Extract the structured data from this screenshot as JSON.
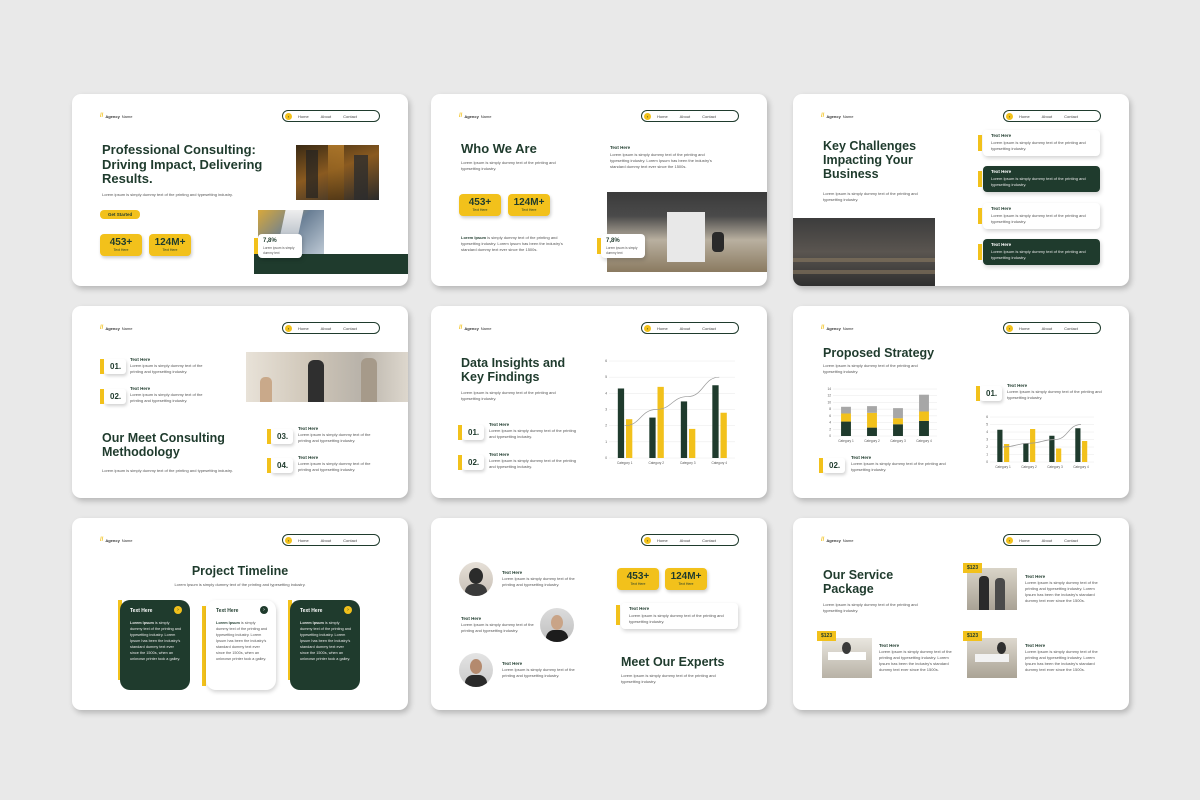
{
  "brand": {
    "name": "Agency",
    "name2": "Name"
  },
  "nav": {
    "home": "Home",
    "about": "About",
    "contact": "Contact"
  },
  "colors": {
    "yellow": "#f2c11b",
    "green": "#1f3b2d"
  },
  "lorem_short": "Lorem Ipsum is simply dummy text of the printing and typesetting industry.",
  "text_here": "Text Here",
  "s1": {
    "title": "Professional Consulting: Driving Impact, Delivering Results.",
    "sub": "Lorem ipsum is simply dummy text of the printing and typesetting industry.",
    "button": "Get Started",
    "stat1": "453+",
    "stat2": "124M+",
    "stat_cap": "Text Here",
    "mini_val": "7,8%",
    "mini_text": "Lorem ipsum is simply dummy text"
  },
  "s2": {
    "title": "Who We Are",
    "sub": "Lorem Ipsum is simply dummy text of the printing and typesetting industry.",
    "label": "Text Here",
    "right_text": "Lorem Ipsum is simply dummy text of the printing and typesetting industry. Lorem Ipsum has been the industry's standard dummy text ever since the 1500s.",
    "stat1": "453+",
    "stat2": "124M+",
    "stat_cap": "Text Here",
    "bottom_bold": "Lorem Ipsum",
    "bottom_text": "is simply dummy text of the printing and typesetting industry. Lorem Ipsum has been the industry's standard dummy text ever since the 1500s.",
    "mini_val": "7,8%",
    "mini_text": "Lorem ipsum is simply dummy text"
  },
  "s3": {
    "title": "Key Challenges Impacting Your Business",
    "sub": "Lorem Ipsum is simply dummy text of the printing and typesetting industry.",
    "items": [
      {
        "label": "Text Here",
        "text": "Lorem Ipsum is simply dummy text of the printing and typesetting industry."
      },
      {
        "label": "Text Here",
        "text": "Lorem Ipsum is simply dummy text of the printing and typesetting industry."
      },
      {
        "label": "Text Here",
        "text": "Lorem Ipsum is simply dummy text of the printing and typesetting industry."
      },
      {
        "label": "Text Here",
        "text": "Lorem Ipsum is simply dummy text of the printing and typesetting industry."
      }
    ]
  },
  "s4": {
    "title": "Our Meet Consulting Methodology",
    "sub": "Lorem ipsum is simply dummy text of the printing and typesetting industry.",
    "steps": [
      {
        "num": "01.",
        "label": "Text Here",
        "text": "Lorem ipsum is simply dummy text of the printing and typesetting industry."
      },
      {
        "num": "02.",
        "label": "Text Here",
        "text": "Lorem ipsum is simply dummy text of the printing and typesetting industry."
      },
      {
        "num": "03.",
        "label": "Text Here",
        "text": "Lorem ipsum is simply dummy text of the printing and typesetting industry."
      },
      {
        "num": "04.",
        "label": "Text Here",
        "text": "Lorem ipsum is simply dummy text of the printing and typesetting industry."
      }
    ]
  },
  "s5": {
    "title": "Data Insights and Key Findings",
    "sub": "Lorem Ipsum is simply dummy text of the printing and typesetting industry.",
    "steps": [
      {
        "num": "01.",
        "label": "Text Here",
        "text": "Lorem Ipsum is simply dummy text of the printing and typesetting industry."
      },
      {
        "num": "02.",
        "label": "Text Here",
        "text": "Lorem Ipsum is simply dummy text of the printing and typesetting industry."
      }
    ]
  },
  "s6": {
    "title": "Proposed Strategy",
    "sub": "Lorem Ipsum is simply dummy text of the printing and typesetting industry.",
    "steps": [
      {
        "num": "01.",
        "label": "Text Here",
        "text": "Lorem Ipsum is simply dummy text of the printing and typesetting industry."
      },
      {
        "num": "02.",
        "label": "Text Here",
        "text": "Lorem Ipsum is simply dummy text of the printing and typesetting industry."
      }
    ]
  },
  "s7": {
    "title": "Project Timeline",
    "sub": "Lorem Ipsum is simply dummy text of the printing and typesetting industry.",
    "cards": [
      {
        "label": "Text Here",
        "bold": "Lorem Ipsum",
        "text": "is simply dummy text of the printing and typesetting industry. Lorem Ipsum has been the industry's standard dummy text ever since the 1500s, when an unknown printer took a galley."
      },
      {
        "label": "Text Here",
        "bold": "Lorem Ipsum",
        "text": "is simply dummy text of the printing and typesetting industry. Lorem Ipsum has been the industry's standard dummy text ever since the 1500s, when an unknown printer took a galley."
      },
      {
        "label": "Text Here",
        "bold": "Lorem Ipsum",
        "text": "is simply dummy text of the printing and typesetting industry. Lorem Ipsum has been the industry's standard dummy text ever since the 1500s, when an unknown printer took a galley."
      }
    ]
  },
  "s8": {
    "title": "Meet Our Experts",
    "sub": "Lorem Ipsum is simply dummy text of the printing and typesetting industry.",
    "stat1": "453+",
    "stat2": "124M+",
    "stat_cap": "Text Here",
    "card_label": "Text Here",
    "card_text": "Lorem Ipsum is simply dummy text of the printing and typesetting industry.",
    "experts": [
      {
        "label": "Text Here",
        "text": "Lorem Ipsum is simply dummy text of the printing and typesetting industry."
      },
      {
        "label": "Text Here",
        "text": "Lorem Ipsum is simply dummy text of the printing and typesetting industry."
      },
      {
        "label": "Text Here",
        "text": "Lorem Ipsum is simply dummy text of the printing and typesetting industry."
      }
    ]
  },
  "s9": {
    "title": "Our Service Package",
    "sub": "Lorem Ipsum is simply dummy text of the printing and typesetting industry.",
    "packages": [
      {
        "price": "$123",
        "label": "Text Here",
        "text": "Lorem Ipsum is simply dummy text of the printing and typesetting industry. Lorem Ipsum has been the industry's standard dummy text ever since the 1500s."
      },
      {
        "price": "$123",
        "label": "Text Here",
        "text": "Lorem Ipsum is simply dummy text of the printing and typesetting industry. Lorem Ipsum has been the industry's standard dummy text ever since the 1500s."
      },
      {
        "price": "$123",
        "label": "Text Here",
        "text": "Lorem Ipsum is simply dummy text of the printing and typesetting industry. Lorem Ipsum has been the industry's standard dummy text ever since the 1500s."
      }
    ]
  },
  "chart_data": [
    {
      "type": "bar",
      "categories": [
        "Category 1",
        "Category 2",
        "Category 3",
        "Category 4"
      ],
      "series": [
        {
          "values": [
            4.3,
            2.5,
            3.5,
            4.5
          ]
        },
        {
          "values": [
            2.4,
            4.4,
            1.8,
            2.8
          ]
        }
      ],
      "line": [
        2.0,
        3.0,
        3.8,
        5.0
      ],
      "ylim": [
        0,
        6
      ],
      "yticks": [
        "0",
        "1",
        "2",
        "3",
        "4",
        "5",
        "6"
      ]
    },
    {
      "type": "bar",
      "stacked": true,
      "categories": [
        "Category 1",
        "Category 2",
        "Category 3",
        "Category 4"
      ],
      "series": [
        {
          "values": [
            4.3,
            2.5,
            3.5,
            4.5
          ]
        },
        {
          "values": [
            2.4,
            4.4,
            1.8,
            2.8
          ]
        },
        {
          "values": [
            2,
            2,
            3,
            5
          ]
        }
      ],
      "ylim": [
        0,
        14
      ],
      "yticks": [
        "0",
        "2",
        "4",
        "6",
        "8",
        "10",
        "12",
        "14"
      ]
    },
    {
      "type": "bar",
      "categories": [
        "Category 1",
        "Category 2",
        "Category 3",
        "Category 4"
      ],
      "series": [
        {
          "values": [
            4.3,
            2.5,
            3.5,
            4.5
          ]
        },
        {
          "values": [
            2.4,
            4.4,
            1.8,
            2.8
          ]
        }
      ],
      "line": [
        2.0,
        2.5,
        3.0,
        5.0
      ],
      "ylim": [
        0,
        6
      ],
      "yticks": [
        "0",
        "1",
        "2",
        "3",
        "4",
        "5",
        "6"
      ]
    }
  ]
}
